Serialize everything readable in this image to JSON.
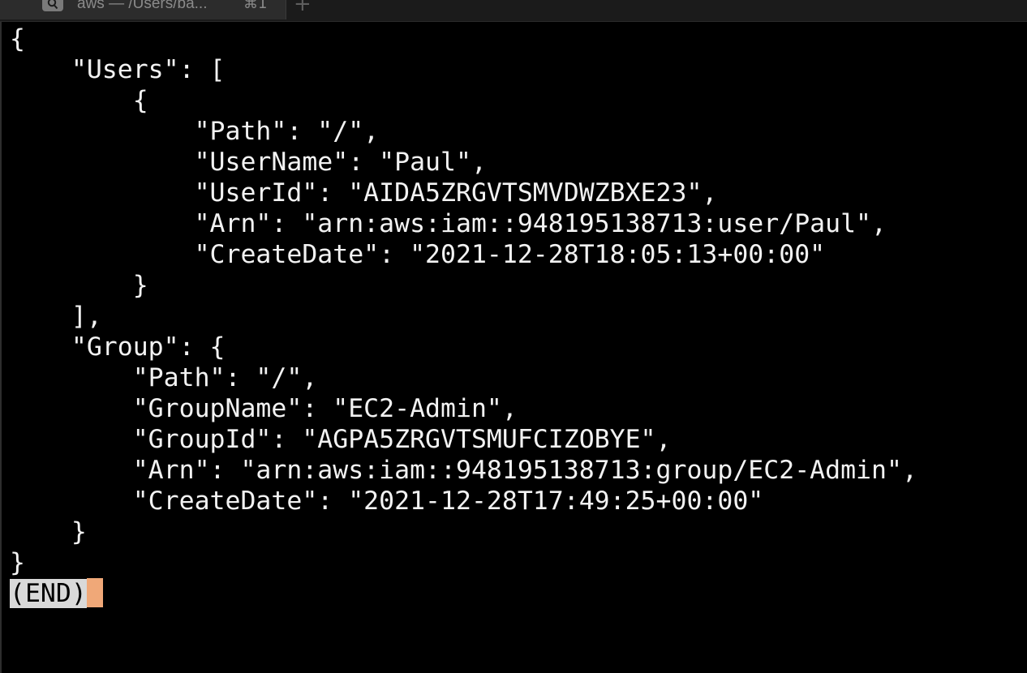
{
  "tab": {
    "title": "aws — /Users/ba...",
    "shortcut": "⌘1",
    "new_tab_label": "+"
  },
  "terminal": {
    "lines": [
      "{",
      "    \"Users\": [",
      "        {",
      "            \"Path\": \"/\",",
      "            \"UserName\": \"Paul\",",
      "            \"UserId\": \"AIDA5ZRGVTSMVDWZBXE23\",",
      "            \"Arn\": \"arn:aws:iam::948195138713:user/Paul\",",
      "            \"CreateDate\": \"2021-12-28T18:05:13+00:00\"",
      "        }",
      "    ],",
      "    \"Group\": {",
      "        \"Path\": \"/\",",
      "        \"GroupName\": \"EC2-Admin\",",
      "        \"GroupId\": \"AGPA5ZRGVTSMUFCIZOBYE\",",
      "        \"Arn\": \"arn:aws:iam::948195138713:group/EC2-Admin\",",
      "        \"CreateDate\": \"2021-12-28T17:49:25+00:00\"",
      "    }",
      "}"
    ],
    "end_marker": "(END)"
  },
  "colors": {
    "background": "#000000",
    "text": "#f2f2f2",
    "cursor": "#f0a878",
    "end_highlight": "#d9d9d9"
  },
  "icons": {
    "tab_icon": "search-icon"
  }
}
